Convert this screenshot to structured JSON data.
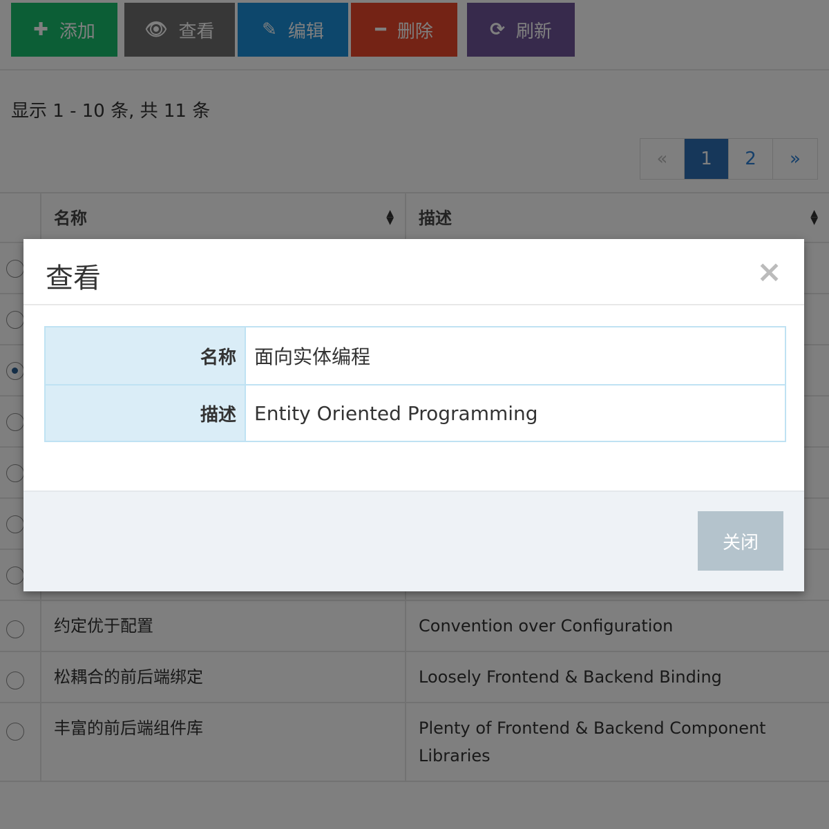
{
  "toolbar": {
    "add_label": "添加",
    "view_label": "查看",
    "edit_label": "编辑",
    "delete_label": "删除",
    "refresh_label": "刷新"
  },
  "colors": {
    "add": "#18bc6c",
    "view": "#6e6e6e",
    "edit": "#1a8fd9",
    "delete": "#e8472a",
    "refresh": "#6f5499",
    "page_active": "#2c6fb4"
  },
  "pagination": {
    "info": "显示 1 - 10 条, 共 11 条",
    "prev": "«",
    "pages": [
      "1",
      "2"
    ],
    "active_page": "1",
    "next": "»"
  },
  "table": {
    "columns": [
      "名称",
      "描述"
    ],
    "rows": [
      {
        "name": "约定优于配置",
        "desc": "Convention over Configuration"
      },
      {
        "name": "松耦合的前后端绑定",
        "desc": "Loosely Frontend & Backend Binding"
      },
      {
        "name": "丰富的前后端组件库",
        "desc": "Plenty of Frontend & Backend Component Libraries"
      }
    ]
  },
  "modal": {
    "title": "查看",
    "close_icon": "×",
    "fields": [
      {
        "label": "名称",
        "value": "面向实体编程"
      },
      {
        "label": "描述",
        "value": "Entity Oriented Programming"
      }
    ],
    "close_button": "关闭"
  }
}
